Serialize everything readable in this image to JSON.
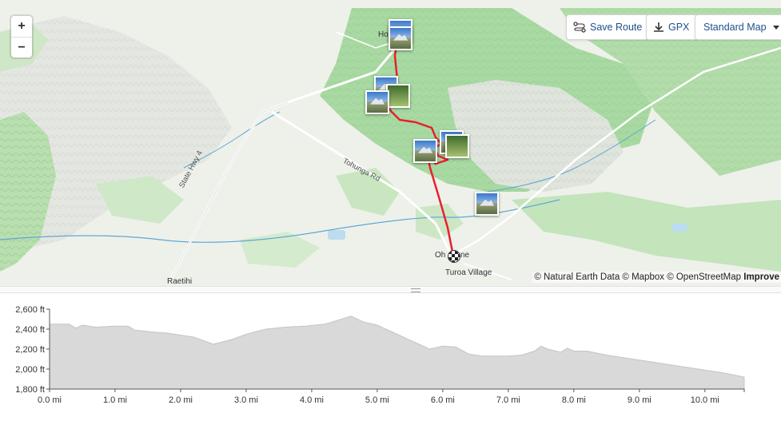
{
  "map": {
    "zoom_in": "+",
    "zoom_out": "−",
    "controls": {
      "save_route": "Save Route",
      "gpx": "GPX",
      "map_style": "Standard Map"
    },
    "places": {
      "top": "Ho",
      "oh": "Oh",
      "ne": "ne",
      "village": "Turoa Village",
      "raetihi": "Raetihi"
    },
    "roads": {
      "hwy": "State Hwy 4",
      "tohunga": "Tohunga Rd"
    },
    "attribution": {
      "text": "© Natural Earth Data © Mapbox © OpenStreetMap ",
      "improve": "Improve"
    },
    "colors": {
      "route": "#e8202f",
      "forest": "#a9d9a2",
      "river": "#5fa7d4"
    },
    "icons": [
      "plus-icon",
      "minus-icon",
      "route-icon",
      "download-icon",
      "caret-down-icon",
      "photo-icon",
      "checkered-flag-icon"
    ]
  },
  "chart_data": {
    "type": "area",
    "xlabel": "",
    "ylabel": "",
    "xlim": [
      0,
      10.6
    ],
    "ylim": [
      1800,
      2600
    ],
    "y_ticks": [
      "1,800 ft",
      "2,000 ft",
      "2,200 ft",
      "2,400 ft",
      "2,600 ft"
    ],
    "x_ticks": [
      "0.0 mi",
      "1.0 mi",
      "2.0 mi",
      "3.0 mi",
      "4.0 mi",
      "5.0 mi",
      "6.0 mi",
      "7.0 mi",
      "8.0 mi",
      "9.0 mi",
      "10.0 mi"
    ],
    "series": [
      {
        "x": [
          0.0,
          0.3,
          0.4,
          0.5,
          0.7,
          1.0,
          1.2,
          1.3,
          1.6,
          1.8,
          2.0,
          2.2,
          2.5,
          2.8,
          3.0,
          3.3,
          3.6,
          3.9,
          4.2,
          4.4,
          4.6,
          4.8,
          5.0,
          5.2,
          5.4,
          5.6,
          5.8,
          6.0,
          6.2,
          6.4,
          6.6,
          6.8,
          7.0,
          7.2,
          7.4,
          7.5,
          7.6,
          7.8,
          7.9,
          8.0,
          8.2,
          8.5,
          9.0,
          9.5,
          10.0,
          10.3,
          10.6
        ],
        "y": [
          2450,
          2450,
          2410,
          2440,
          2420,
          2430,
          2430,
          2390,
          2370,
          2360,
          2340,
          2320,
          2250,
          2300,
          2350,
          2400,
          2420,
          2430,
          2450,
          2490,
          2530,
          2470,
          2440,
          2380,
          2320,
          2260,
          2200,
          2230,
          2220,
          2150,
          2130,
          2130,
          2130,
          2140,
          2180,
          2230,
          2200,
          2170,
          2210,
          2180,
          2180,
          2140,
          2090,
          2040,
          1990,
          1960,
          1920
        ]
      }
    ]
  }
}
